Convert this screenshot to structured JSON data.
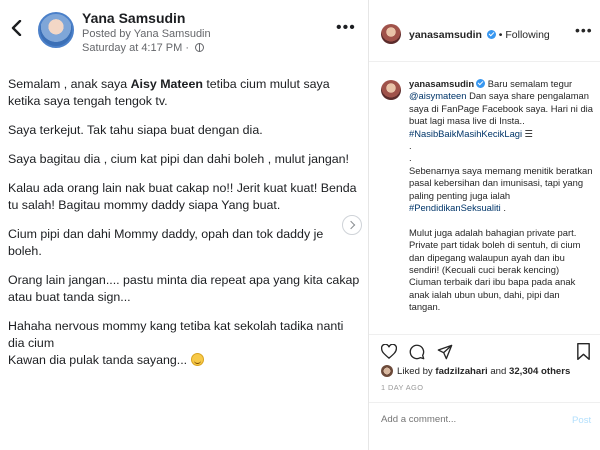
{
  "facebook": {
    "author": "Yana Samsudin",
    "posted_by": "Posted by Yana Samsudin",
    "time": "Saturday at 4:17 PM",
    "time_sep": " · ",
    "paragraphs": {
      "p1_before": "Semalam , anak saya ",
      "p1_bold": "Aisy Mateen",
      "p1_after": " tetiba cium mulut saya ketika saya tengah tengok tv.",
      "p2": "Saya  terkejut. Tak tahu siapa buat dengan dia.",
      "p3": "Saya bagitau dia , cium kat pipi dan dahi boleh , mulut jangan!",
      "p4": "Kalau ada orang lain nak buat cakap no!! Jerit kuat kuat! Benda tu salah! Bagitau mommy daddy siapa Yang buat.",
      "p5": "Cium pipi dan dahi Mommy daddy, opah dan tok daddy je boleh.",
      "p6": "Orang lain jangan.... pastu minta dia repeat apa yang kita cakap atau buat tanda sign...",
      "p7": "Hahaha nervous mommy kang tetiba kat sekolah tadika nanti dia cium",
      "p8": "Kawan dia pulak tanda sayang... "
    }
  },
  "instagram": {
    "username": "yanasamsudin",
    "follow_status": "• Following",
    "caption": {
      "username": "yanasamsudin",
      "line1": " Baru semalam tegur ",
      "mention": "@aisymateen",
      "line1b": " Dan saya share pengalaman saya di FanPage Facebook saya. Hari ni dia buat lagi masa live di Insta.. ",
      "hashtag1": "#NasibBaikMasihKecikLagi",
      "dot1": ".",
      "dot2": ".",
      "para2": "Sebenarnya saya memang menitik beratkan pasal kebersihan dan imunisasi, tapi yang paling penting juga ialah ",
      "hashtag2": "#PendidikanSeksualiti",
      "para2_end": " .",
      "para3": "Mulut juga adalah bahagian private part. Private part tidak boleh di sentuh, di cium dan dipegang walaupun ayah dan ibu sendiri! (Kecuali cuci berak kencing) Ciuman terbaik dari ibu bapa pada anak anak ialah ubun ubun, dahi, pipi dan tangan."
    },
    "likes_prefix": "Liked by ",
    "liked_by_user": "fadzilzahari",
    "likes_and": " and ",
    "likes_count": "32,304 others",
    "date": "1 DAY AGO",
    "comment_placeholder": "Add a comment...",
    "post_label": "Post"
  },
  "icons": {
    "back": "chevron-left-icon",
    "more": "more-horizontal-icon",
    "globe": "globe-icon",
    "verified": "verified-badge-icon",
    "heart": "heart-icon",
    "comment": "comment-icon",
    "share": "share-icon",
    "bookmark": "bookmark-icon",
    "next": "chevron-right-icon",
    "emoji": "grimacing-emoji-icon"
  },
  "colors": {
    "ig_link": "#003569",
    "ig_verified": "#3897f0",
    "ig_post_disabled": "#b2dffc",
    "fb_secondary": "#65676b"
  }
}
